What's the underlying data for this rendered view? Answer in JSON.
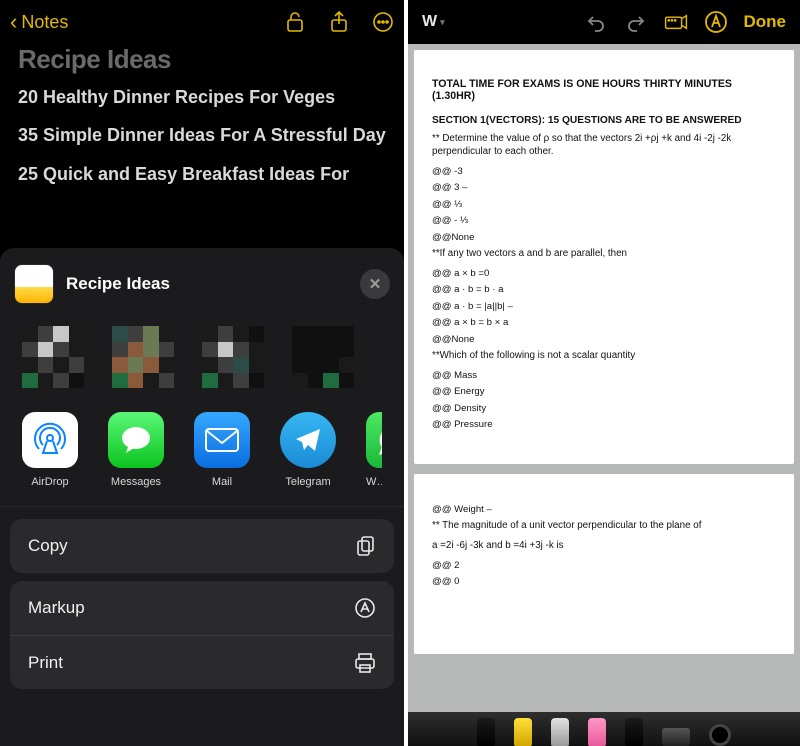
{
  "left": {
    "nav_back_label": "Notes",
    "note_title": "Recipe Ideas",
    "note_lines": [
      "20 Healthy Dinner Recipes For Veges",
      "35 Simple Dinner Ideas For A Stressful Day",
      "25 Quick and Easy Breakfast Ideas For"
    ],
    "share": {
      "title": "Recipe Ideas",
      "apps": [
        {
          "label": "AirDrop"
        },
        {
          "label": "Messages"
        },
        {
          "label": "Mail"
        },
        {
          "label": "Telegram"
        },
        {
          "label": "Wh"
        }
      ],
      "actions": {
        "copy": "Copy",
        "markup": "Markup",
        "print": "Print"
      }
    }
  },
  "right": {
    "w_label": "W",
    "done_label": "Done",
    "page1": {
      "heading": "TOTAL TIME FOR EXAMS IS ONE HOURS THIRTY MINUTES (1.30HR)",
      "section": "SECTION 1(VECTORS): 15 QUESTIONS ARE TO BE ANSWERED",
      "q1": "** Determine the value of  ρ so that the vectors 2i  +ρj  +k and 4i -2j -2k perpendicular to each other.",
      "q1_opts": [
        "@@  -3",
        "@@ 3        –",
        "@@ ⅓",
        "@@  - ⅓",
        "@@None"
      ],
      "q2": "**If any two vectors  a  and  b  are parallel, then",
      "q2_opts": [
        "@@  a  × b  =0",
        "@@  a · b  = b · a",
        "@@  a · b  = |a||b|      –",
        "@@  a × b  = b × a",
        "@@None"
      ],
      "q3": "**Which of the following is not a scalar quantity",
      "q3_opts": [
        "@@ Mass",
        "@@ Energy",
        "@@ Density",
        "@@ Pressure"
      ]
    },
    "page2": {
      "opt_top": "@@ Weight –",
      "q4": "** The magnitude of a unit vector perpendicular to the plane of",
      "q4_desc": "a  =2i -6j -3k and      b  =4i  +3j -k is",
      "q4_opts": [
        "@@ 2",
        "@@ 0"
      ]
    }
  }
}
